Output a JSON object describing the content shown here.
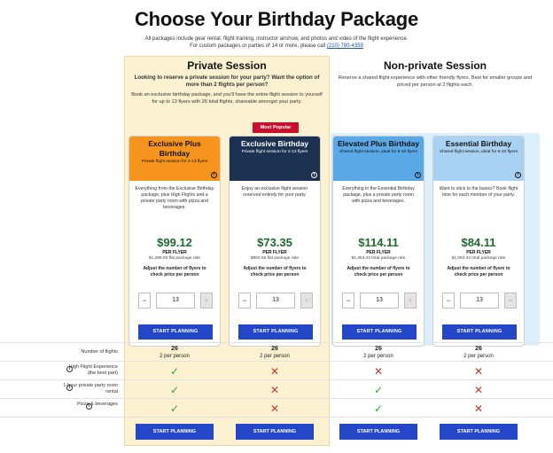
{
  "title": "Choose Your Birthday Package",
  "intro": {
    "line1": "All packages include gear rental, flight training, instructor airshow, and photos and video of the flight experience.",
    "line2_prefix": "For custom packages or parties of 14 or more, please call ",
    "phone": "(210) 780-4359"
  },
  "private": {
    "title": "Private Session",
    "lead": "Looking to reserve a private session for your party? Want the option of more than 2 flights per person?",
    "desc": "Book an exclusive birthday package, and you'll have the entire flight session to yourself for up to 13 flyers with 26 total flights, shareable amongst your party."
  },
  "nonprivate": {
    "title": "Non-private Session",
    "desc": "Reserve a shared flight experience with other friendly flyers. Best for smaller groups and priced per person at 2 flights each."
  },
  "badge": "Most Popular",
  "cards": [
    {
      "name": "Exclusive Plus Birthday",
      "sub": "Private flight session for 2-13 flyers",
      "desc": "Everything from the Exclusive Birthday package, plus High Flights and a private party room with pizza and beverages.",
      "price": "$99.12",
      "per": "PER FLYER",
      "total": "$1,288.55 flat package rate",
      "adjust": "Adjust the number of flyers to check price per person",
      "qty": "13",
      "plan": "START PLANNING",
      "head_bg": "#f7941d",
      "head_fg": "#111111"
    },
    {
      "name": "Exclusive Birthday",
      "sub": "Private flight session for 2-13 flyers",
      "desc": "Enjoy an exclusive flight session reserved entirely for your party.",
      "price": "$73.35",
      "per": "PER FLYER",
      "total": "$953.55 flat package rate",
      "adjust": "Adjust the number of flyers to check price per person",
      "qty": "13",
      "plan": "START PLANNING",
      "head_bg": "#1c3250",
      "head_fg": "#ffffff"
    },
    {
      "name": "Elevated Plus Birthday",
      "sub": "Shared flight session, ideal for 6-10 flyers",
      "desc": "Everything in the Essential Birthday package, plus a private party room with pizza and beverages.",
      "price": "$114.11",
      "per": "PER FLYER",
      "total": "$1,483.43 total package rate",
      "adjust": "Adjust the number of flyers to check price per person",
      "qty": "13",
      "plan": "START PLANNING",
      "head_bg": "#5aa9e6",
      "head_fg": "#111111"
    },
    {
      "name": "Essential Birthday",
      "sub": "Shared flight session, ideal for 6-10 flyers",
      "desc": "Want to stick to the basics? Book flight time for each member of your party.",
      "price": "$84.11",
      "per": "PER FLYER",
      "total": "$1,093.43 total package rate",
      "adjust": "Adjust the number of flyers to check price per person",
      "qty": "13",
      "plan": "START PLANNING",
      "head_bg": "#a9d2f2",
      "head_fg": "#111111"
    }
  ],
  "stepper": {
    "minus": "−",
    "plus": "+"
  },
  "features": {
    "flights_label": "Number of flights",
    "flights_count": "26",
    "flights_sub": "2 per person",
    "rows": [
      {
        "label": "High Flight Experience (the best part)",
        "marks": [
          "check",
          "cross",
          "cross",
          "cross"
        ]
      },
      {
        "label": "1-hour private party room rental",
        "marks": [
          "check",
          "cross",
          "check",
          "cross"
        ]
      },
      {
        "label": "Pizza & beverages",
        "marks": [
          "check",
          "cross",
          "check",
          "cross"
        ]
      }
    ]
  },
  "bottom_plan": "START PLANNING",
  "colors": {
    "plan_button": "#2447c9",
    "price": "#1e6b2e",
    "badge": "#c8102e",
    "check": "#35a12d",
    "cross": "#d0352a",
    "private_bg": "#fcf2d2",
    "nonprivate_bg": "#dbeefb"
  },
  "icons": {
    "info": "i",
    "check": "✓",
    "cross": "✕"
  }
}
